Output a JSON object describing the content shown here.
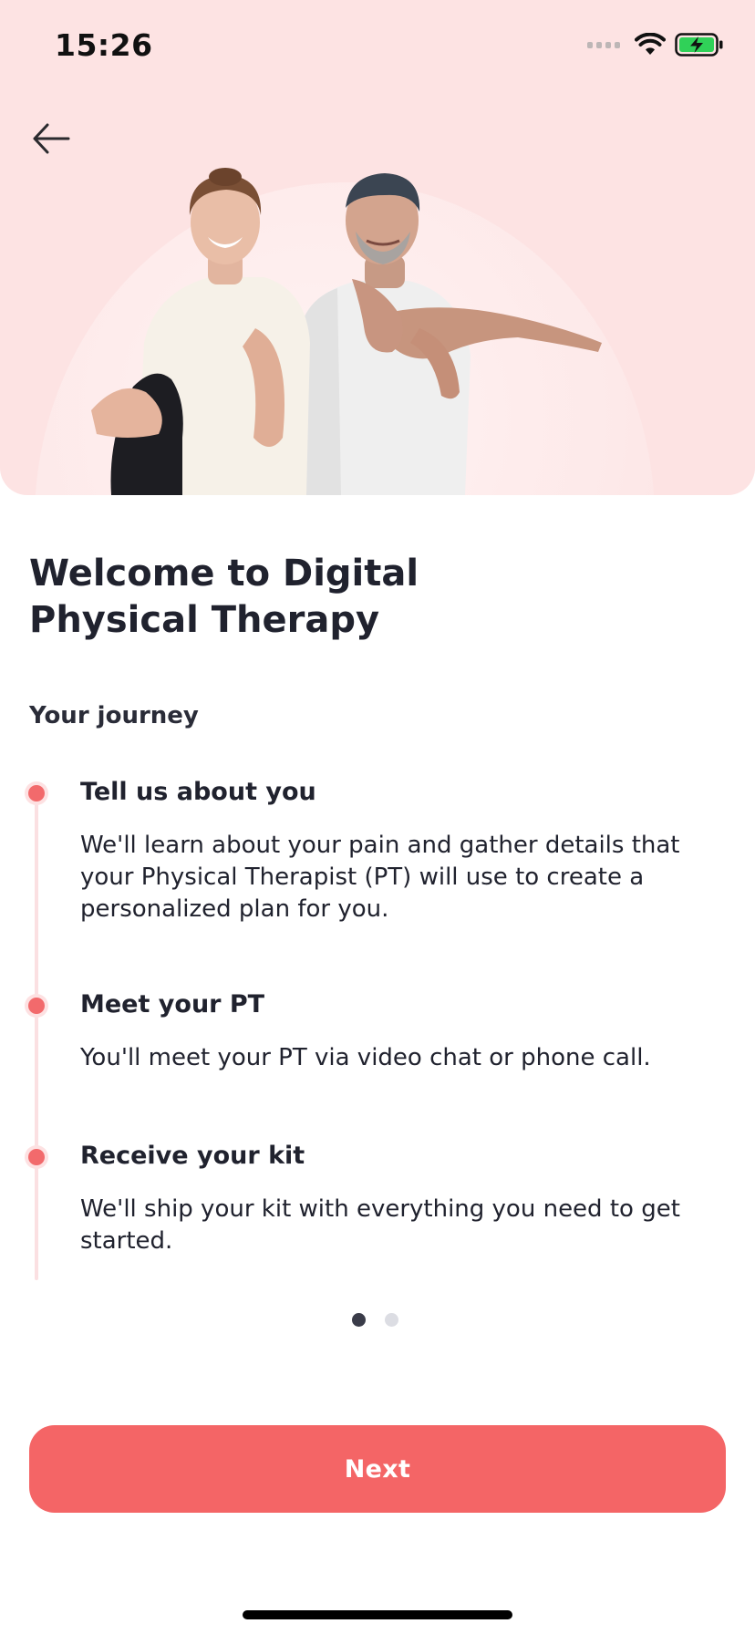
{
  "status_bar": {
    "time": "15:26",
    "icons": [
      "signal-icon",
      "wifi-icon",
      "battery-charging-icon"
    ]
  },
  "header": {
    "back_icon": "arrow-left-icon"
  },
  "content": {
    "title": "Welcome to Digital\nPhysical Therapy",
    "section_label": "Your journey",
    "steps": [
      {
        "title": "Tell us about you",
        "description": "We'll learn about your pain and gather details that your Physical Therapist (PT) will use to create a personalized plan for you."
      },
      {
        "title": "Meet your PT",
        "description": "You'll meet your PT via video chat or phone call."
      },
      {
        "title": "Receive your kit",
        "description": "We'll ship your kit with everything you need to get started."
      }
    ]
  },
  "pager": {
    "total": 2,
    "current": 1
  },
  "footer": {
    "next_label": "Next"
  },
  "colors": {
    "hero_background": "#fde3e3",
    "accent": "#f46566",
    "timeline_line": "#fbe0e2",
    "text_primary": "#20222e",
    "pager_active": "#3a3c49",
    "pager_inactive": "#dcdde3"
  }
}
